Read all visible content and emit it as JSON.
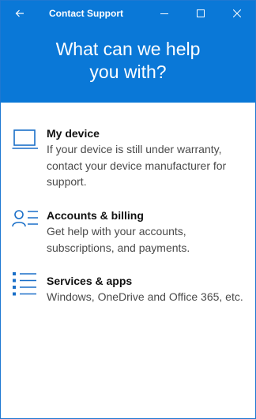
{
  "window": {
    "title": "Contact Support",
    "accent_color": "#0a78d7"
  },
  "titlebar": {
    "back_icon": "back-arrow-icon",
    "minimize_icon": "minimize-icon",
    "maximize_icon": "maximize-icon",
    "close_icon": "close-icon"
  },
  "hero": {
    "line1": "What can we help",
    "line2": "you with?"
  },
  "options": [
    {
      "icon": "laptop-icon",
      "title": "My device",
      "description": "If your device is still under warranty, contact your device manufacturer for support."
    },
    {
      "icon": "accounts-icon",
      "title": "Accounts & billing",
      "description": "Get help with your accounts, subscriptions, and payments."
    },
    {
      "icon": "services-list-icon",
      "title": "Services & apps",
      "description": "Windows, OneDrive and Office 365, etc."
    }
  ]
}
